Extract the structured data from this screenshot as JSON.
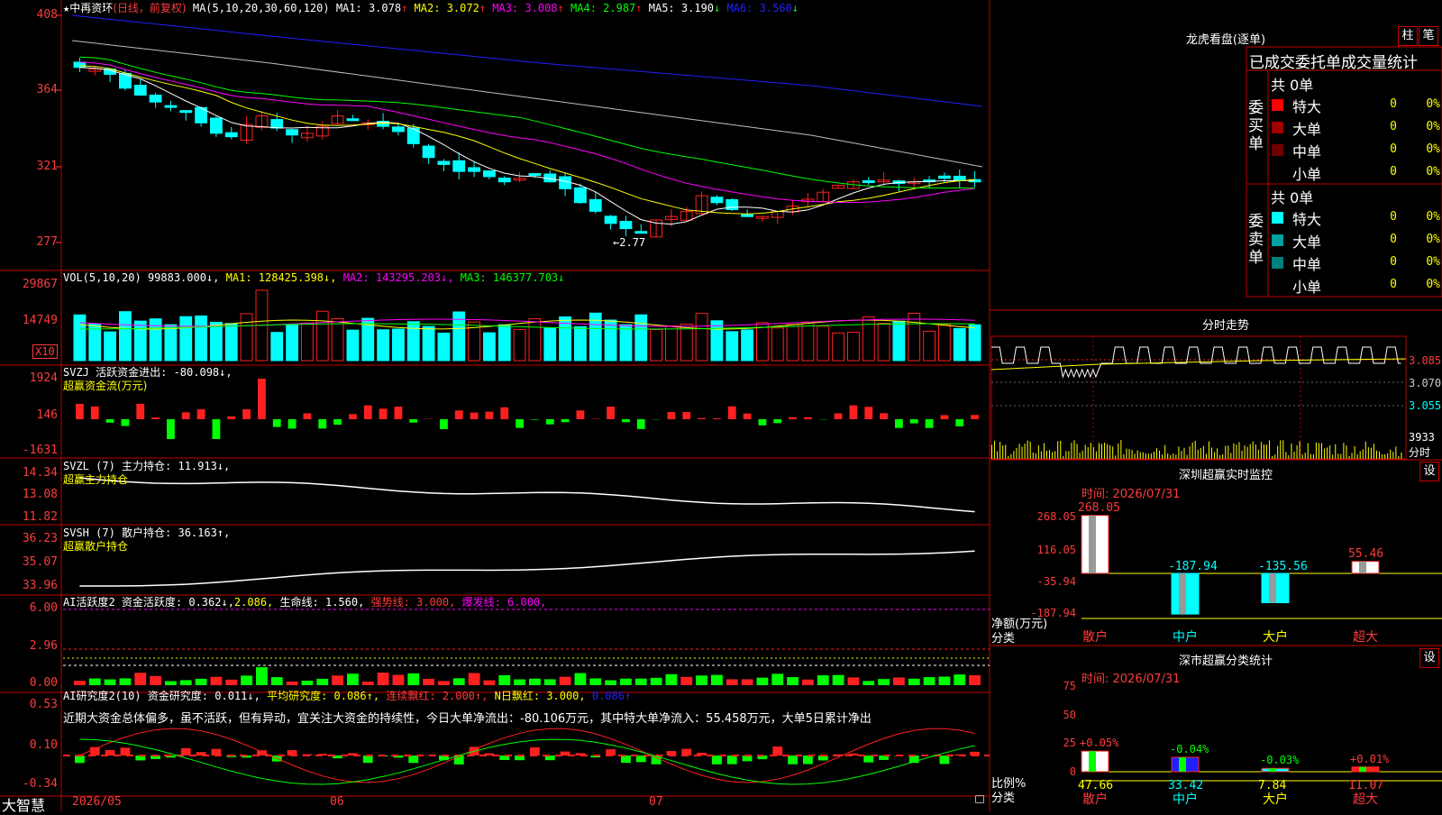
{
  "colors": {
    "up": "#ff2020",
    "down": "#00ffff",
    "ma1": "#ffffff",
    "ma2": "#ffff00",
    "ma3": "#ff00ff",
    "ma4": "#00ff00",
    "ma5": "#c0c0c0",
    "ma6": "#2020ff",
    "grid": "#c00000"
  },
  "price_panel": {
    "star": "★",
    "name": "中再资环",
    "mode": "(日线，前复权)",
    "ma_label": "MA(5,10,20,30,60,120)",
    "ma": [
      {
        "label": "MA1:",
        "value": "3.078",
        "arrow": "↑",
        "color": "#ffffff"
      },
      {
        "label": "MA2:",
        "value": "3.072",
        "arrow": "↑",
        "color": "#ffff00"
      },
      {
        "label": "MA3:",
        "value": "3.008",
        "arrow": "↑",
        "color": "#ff00ff"
      },
      {
        "label": "MA4:",
        "value": "2.987",
        "arrow": "↑",
        "color": "#00ff00"
      },
      {
        "label": "MA5:",
        "value": "3.190",
        "arrow": "↓",
        "color": "#ffffff"
      },
      {
        "label": "MA6:",
        "value": "3.560",
        "arrow": "↓",
        "color": "#2020ff"
      }
    ],
    "yticks": [
      "408",
      "364",
      "321",
      "277"
    ],
    "low_label": "←2.77"
  },
  "vol_panel": {
    "title": "VOL(5,10,20)",
    "v": "99883.000↓,",
    "ma": [
      {
        "text": "MA1: 128425.398↓,",
        "color": "#ffff00"
      },
      {
        "text": "MA2: 143295.203↓,",
        "color": "#ff00ff"
      },
      {
        "text": "MA3: 146377.703↓",
        "color": "#00ff00"
      }
    ],
    "yticks": [
      "29867",
      "14749"
    ],
    "unit": "X10"
  },
  "svzj_panel": {
    "title": "SVZJ  活跃资金进出: -80.098↓,",
    "note": "超赢资金流(万元)",
    "yticks": [
      "1924",
      "146",
      "-1631"
    ]
  },
  "svzl_panel": {
    "title": "SVZL (7) 主力持仓: 11.913↓,",
    "note": "超赢主力持仓",
    "yticks": [
      "14.34",
      "13.08",
      "11.82"
    ]
  },
  "svsh_panel": {
    "title": "SVSH (7) 散户持仓: 36.163↑,",
    "note": "超赢散户持仓",
    "yticks": [
      "36.23",
      "35.07",
      "33.96"
    ]
  },
  "ai_active": {
    "title": "AI活跃度2 资金活跃度: 0.362↓,",
    "v2": "2.086,",
    "v3": "生命线: 1.560,",
    "v4": "强势线: 3.000,",
    "v5": "爆发线: 6.000,",
    "yticks": [
      "6.00",
      "2.96",
      "0.00"
    ]
  },
  "ai_research": {
    "title": "AI研究度2(10) 资金研究度: 0.011↓,",
    "avg": "平均研究度: 0.086↑,",
    "red": "连续飘红: 2.000↑,",
    "nred": "N日飘红: 3.000,",
    "tail": "0.086↑",
    "text": "近期大资金总体偏多，虽不活跃，但有异动，宜关注大资金的持续性，今日大单净流出：-80.106万元，其中特大单净流入：55.458万元，大单5日累计净出",
    "yticks": [
      "0.53",
      "0.10",
      "-0.34"
    ]
  },
  "xaxis": {
    "brand": "大智慧",
    "labels": [
      "2026/05",
      "06",
      "07"
    ]
  },
  "longhu": {
    "title": "龙虎看盘(逐单)",
    "btn1": "柱",
    "btn2": "笔",
    "subtitle": "已成交委托单成交量统计",
    "buy": {
      "side": "委买单",
      "total": "共 0单",
      "rows": [
        {
          "label": "特大",
          "n": "0",
          "pct": "0%",
          "color": "#ff0000"
        },
        {
          "label": "大单",
          "n": "0",
          "pct": "0%",
          "color": "#a00000"
        },
        {
          "label": "中单",
          "n": "0",
          "pct": "0%",
          "color": "#700000"
        },
        {
          "label": "小单",
          "n": "0",
          "pct": "0%",
          "color": "#000000"
        }
      ]
    },
    "sell": {
      "side": "委卖单",
      "total": "共 0单",
      "rows": [
        {
          "label": "特大",
          "n": "0",
          "pct": "0%",
          "color": "#00ffff"
        },
        {
          "label": "大单",
          "n": "0",
          "pct": "0%",
          "color": "#00a0a0"
        },
        {
          "label": "中单",
          "n": "0",
          "pct": "0%",
          "color": "#008080"
        },
        {
          "label": "小单",
          "n": "0",
          "pct": "0%",
          "color": "#000000"
        }
      ]
    }
  },
  "intraday": {
    "title": "分时走势",
    "prices": [
      "3.085",
      "3.070",
      "3.055"
    ],
    "vol": "3933",
    "vol_unit": "分时"
  },
  "sz_monitor": {
    "title": "深圳超赢实时监控",
    "btn": "设",
    "time": "时间: 2026/07/31",
    "yticks": [
      "268.05",
      "116.05",
      "-35.94",
      "-187.94"
    ],
    "ylabel": "净额(万元)",
    "cat_label": "分类",
    "cats": [
      "散户",
      "中户",
      "大户",
      "超大"
    ],
    "values": [
      268.05,
      -187.94,
      -135.56,
      55.46
    ],
    "value_labels": [
      "268.05",
      "-187.94",
      "-135.56",
      "55.46"
    ]
  },
  "sz_class": {
    "title": "深市超赢分类统计",
    "btn": "设",
    "time": "时间: 2026/07/31",
    "yticks": [
      "75",
      "50",
      "25",
      "0"
    ],
    "ylabel": "比例%",
    "cat_label": "分类",
    "cats": [
      "散户",
      "中户",
      "大户",
      "超大"
    ],
    "values": [
      47.66,
      33.42,
      7.84,
      11.07
    ],
    "value_labels": [
      "47.66",
      "33.42",
      "7.84",
      "11.07"
    ],
    "changes": [
      "+0.05%",
      "-0.04%",
      "-0.03%",
      "+0.01%"
    ]
  }
}
